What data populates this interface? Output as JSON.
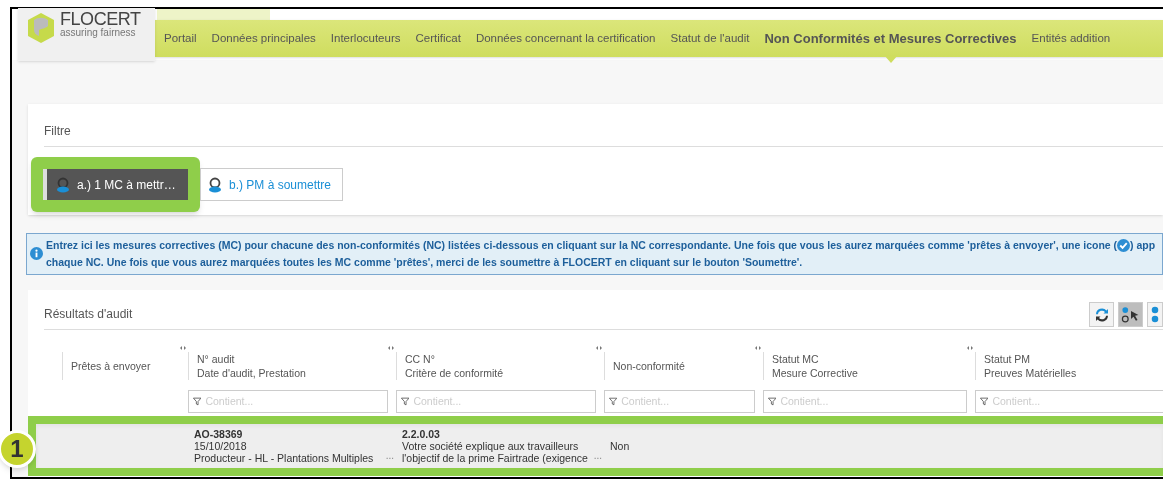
{
  "logo": {
    "name": "FLOCERT",
    "tagline": "assuring fairness"
  },
  "nav": [
    {
      "label": "Portail",
      "selected": false
    },
    {
      "label": "Données principales",
      "selected": false
    },
    {
      "label": "Interlocuteurs",
      "selected": false
    },
    {
      "label": "Certificat",
      "selected": false
    },
    {
      "label": "Données concernant la certification",
      "selected": false
    },
    {
      "label": "Statut de l'audit",
      "selected": false
    },
    {
      "label": "Non Conformités et Mesures Correctives",
      "selected": true
    },
    {
      "label": "Entités addition",
      "selected": false
    }
  ],
  "filter": {
    "title": "Filtre",
    "buttons": [
      {
        "label": "a.) 1 MC à mettr…",
        "selected": true,
        "highlighted": true
      },
      {
        "label": "b.) PM à soumettre",
        "selected": false,
        "highlighted": false
      }
    ]
  },
  "info": {
    "line1_before_icon": "Entrez ici les mesures correctives (MC) pour chacune des non-conformités (NC) listées ci-dessous en cliquant sur la NC correspondante. Une fois que vous les aurez marquées comme 'prêtes à envoyer', une icone (",
    "line1_after_icon": ") app",
    "line2": "chaque NC. Une fois que vous aurez marquées toutes les MC comme 'prêtes', merci de les soumettre à FLOCERT en cliquant sur le bouton 'Soumettre'."
  },
  "results": {
    "title": "Résultats d'audit",
    "toolbar": [
      {
        "kind": "refresh",
        "pressed": false
      },
      {
        "kind": "select",
        "pressed": true
      },
      {
        "kind": "checklist",
        "pressed": false
      }
    ],
    "columns": [
      {
        "lines": [
          "Prêtes à envoyer"
        ]
      },
      {
        "lines": [
          "N° audit",
          "Date d'audit, Prestation"
        ],
        "filter_placeholder": "Contient..."
      },
      {
        "lines": [
          "CC N°",
          "Critère de conformité"
        ],
        "filter_placeholder": "Contient..."
      },
      {
        "lines": [
          "Non-conformité"
        ],
        "filter_placeholder": "Contient..."
      },
      {
        "lines": [
          "Statut MC",
          "Mesure Corrective"
        ],
        "filter_placeholder": "Contient..."
      },
      {
        "lines": [
          "Statut PM",
          "Preuves Matérielles"
        ],
        "filter_placeholder": "Contient..."
      }
    ],
    "rows": [
      {
        "highlighted": true,
        "callout": "1",
        "cells": [
          {},
          {
            "lines": [
              "AO-38369",
              "15/10/2018",
              "Producteur - HL - Plantations Multiples"
            ],
            "more": "..."
          },
          {
            "lines": [
              "2.2.0.03",
              "Votre société explique aux travailleurs",
              "l'objectif de la prime Fairtrade (exigence"
            ],
            "more": "..."
          },
          {
            "lines": [
              "Non"
            ]
          },
          {},
          {}
        ]
      }
    ]
  }
}
